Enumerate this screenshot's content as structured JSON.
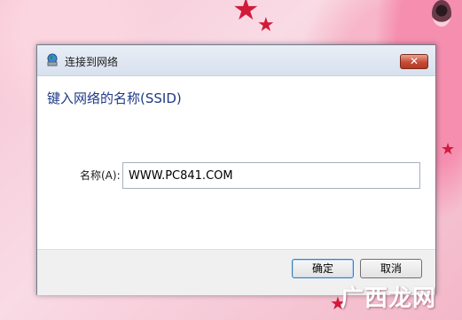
{
  "dialog": {
    "title": "连接到网络",
    "close_label": "✕",
    "heading": "键入网络的名称(SSID)",
    "name_label": "名称(A):",
    "name_value": "WWW.PC841.COM",
    "ok_label": "确定",
    "cancel_label": "取消"
  },
  "watermark": "广西龙网",
  "colors": {
    "heading": "#1f3b86",
    "close_button": "#c74a34",
    "footer": "#f0f0f0"
  }
}
